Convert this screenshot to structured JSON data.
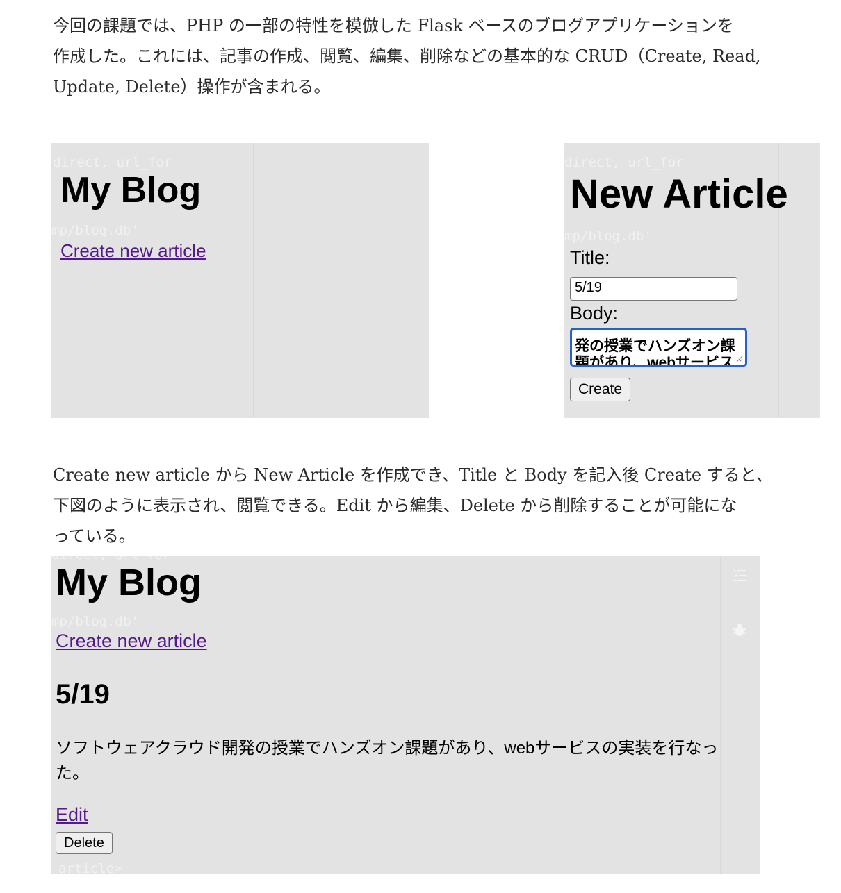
{
  "intro_text": "今回の課題では、PHP の一部の特性を模倣した Flask ベースのブログアプリケーションを\n作成した。これには、記事の作成、閲覧、編集、削除などの基本的な CRUD（Create, Read,\nUpdate, Delete）操作が含まれる。",
  "explain_text": "Create new article から New Article を作成でき、Title と Body を記入後 Create すると、\n下図のように表示され、閲覧できる。Edit から編集、Delete から削除することが可能にな\nっている。",
  "shot_index": {
    "ghost_code_1": "direct, url_for",
    "ghost_code_2": "mp/blog.db'",
    "heading": "My Blog",
    "create_link": "Create new article"
  },
  "shot_new": {
    "ghost_code_1": "direct, url_for",
    "ghost_code_2": "mp/blog.db'",
    "heading": "New Article",
    "title_label": "Title:",
    "title_value": "5/19",
    "body_label": "Body:",
    "body_value": "発の授業でハンズオン課\n題があり、webサービス\nの実装を行なった。",
    "create_button": "Create"
  },
  "shot_article": {
    "ghost_code_1": "direct, url_for",
    "ghost_code_2": "mp/blog.db'",
    "ghost_code_3": "article>",
    "heading": "My Blog",
    "create_link": "Create new article",
    "article_title": "5/19",
    "article_body": "ソフトウェアクラウド開発の授業でハンズオン課題があり、webサービスの実装を行なっ\nた。",
    "edit_link": "Edit",
    "delete_button": "Delete",
    "side_icons": [
      "list-icon",
      "bug-icon"
    ]
  }
}
